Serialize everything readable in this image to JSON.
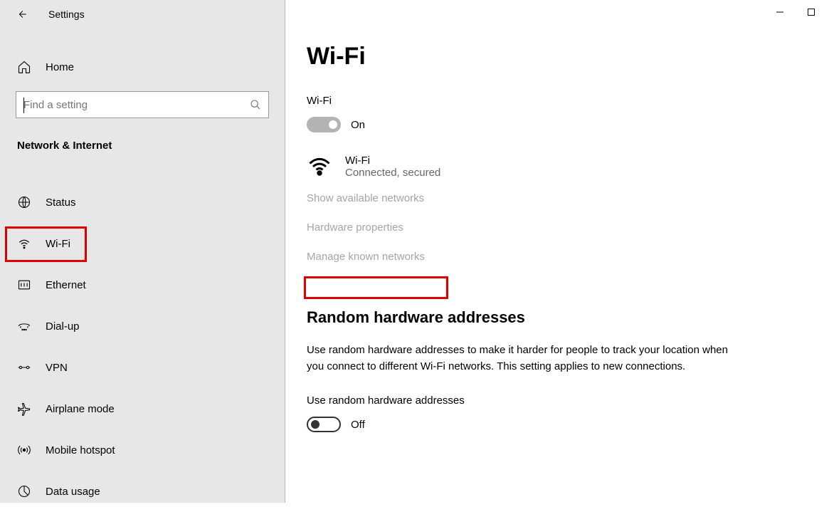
{
  "titlebar": {
    "title": "Settings"
  },
  "sidebar": {
    "home": "Home",
    "search_placeholder": "Find a setting",
    "category": "Network & Internet",
    "items": [
      {
        "label": "Status",
        "icon": "status"
      },
      {
        "label": "Wi-Fi",
        "icon": "wifi"
      },
      {
        "label": "Ethernet",
        "icon": "ethernet"
      },
      {
        "label": "Dial-up",
        "icon": "dialup"
      },
      {
        "label": "VPN",
        "icon": "vpn"
      },
      {
        "label": "Airplane mode",
        "icon": "airplane"
      },
      {
        "label": "Mobile hotspot",
        "icon": "hotspot"
      },
      {
        "label": "Data usage",
        "icon": "data"
      }
    ]
  },
  "main": {
    "title": "Wi-Fi",
    "wifi_label": "Wi-Fi",
    "wifi_toggle_state": "On",
    "network": {
      "name": "Wi-Fi",
      "status": "Connected, secured"
    },
    "links": {
      "show_available": "Show available networks",
      "hardware_props": "Hardware properties",
      "manage_known": "Manage known networks"
    },
    "random_hw": {
      "title": "Random hardware addresses",
      "description": "Use random hardware addresses to make it harder for people to track your location when you connect to different Wi-Fi networks. This setting applies to new connections.",
      "toggle_label": "Use random hardware addresses",
      "toggle_state": "Off"
    }
  }
}
